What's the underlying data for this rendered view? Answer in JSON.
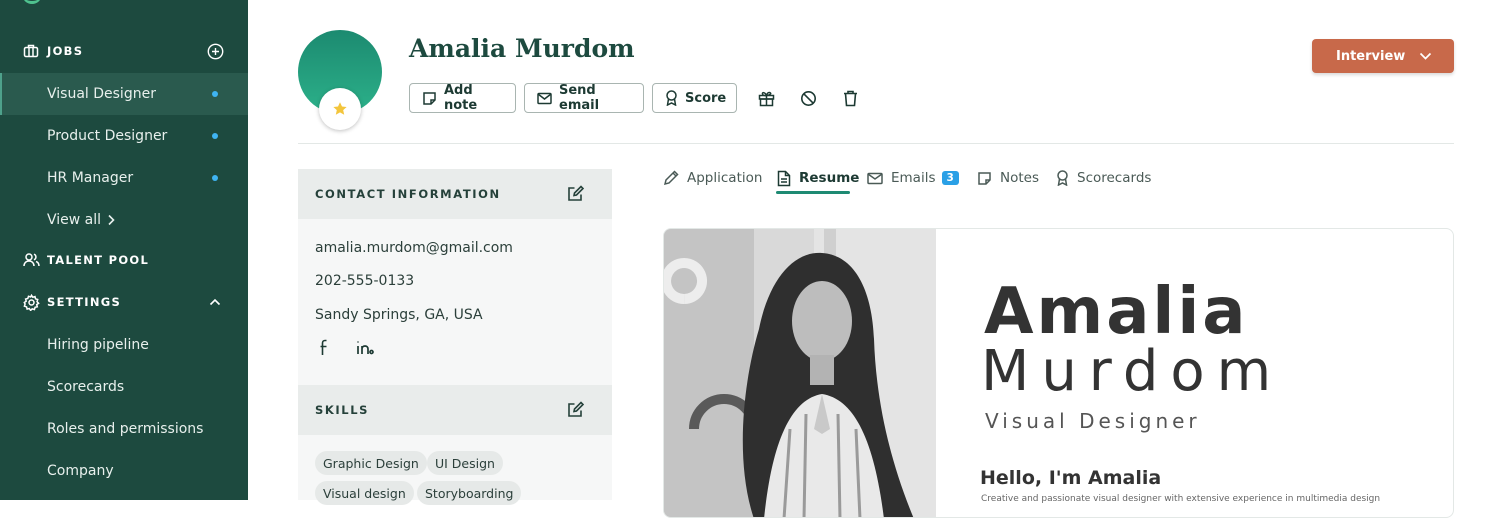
{
  "sidebar": {
    "jobs_label": "JOBS",
    "jobs": [
      {
        "label": "Visual Designer",
        "active": true
      },
      {
        "label": "Product Designer",
        "active": false
      },
      {
        "label": "HR Manager",
        "active": false
      }
    ],
    "view_all": "View all",
    "talent_pool_label": "TALENT POOL",
    "settings_label": "SETTINGS",
    "settings_items": [
      "Hiring pipeline",
      "Scorecards",
      "Roles and permissions",
      "Company"
    ]
  },
  "candidate": {
    "name": "Amalia Murdom",
    "actions": {
      "add_note": "Add note",
      "send_email": "Send email",
      "score": "Score"
    },
    "stage_button": "Interview"
  },
  "contact": {
    "heading": "CONTACT INFORMATION",
    "email": "amalia.murdom@gmail.com",
    "phone": "202-555-0133",
    "location": "Sandy Springs, GA, USA",
    "socials": [
      "facebook-icon",
      "linkedin-icon"
    ]
  },
  "skills": {
    "heading": "SKILLS",
    "items": [
      "Graphic Design",
      "UI Design",
      "Visual design",
      "Storyboarding"
    ]
  },
  "tabs": [
    {
      "label": "Application",
      "icon": "pencil-icon"
    },
    {
      "label": "Resume",
      "icon": "document-icon",
      "active": true
    },
    {
      "label": "Emails",
      "icon": "envelope-icon",
      "count": "3"
    },
    {
      "label": "Notes",
      "icon": "note-icon"
    },
    {
      "label": "Scorecards",
      "icon": "award-icon"
    }
  ],
  "resume": {
    "first_name": "Amalia",
    "last_name": "Murdom",
    "role": "Visual Designer",
    "greeting": "Hello, I'm Amalia",
    "intro": "Creative and passionate visual designer with extensive experience in multimedia design"
  },
  "colors": {
    "sidebar_bg": "#1d4a3f",
    "accent": "#1e8a73",
    "stage_button": "#c8694a",
    "badge_blue": "#2aa0e6"
  }
}
